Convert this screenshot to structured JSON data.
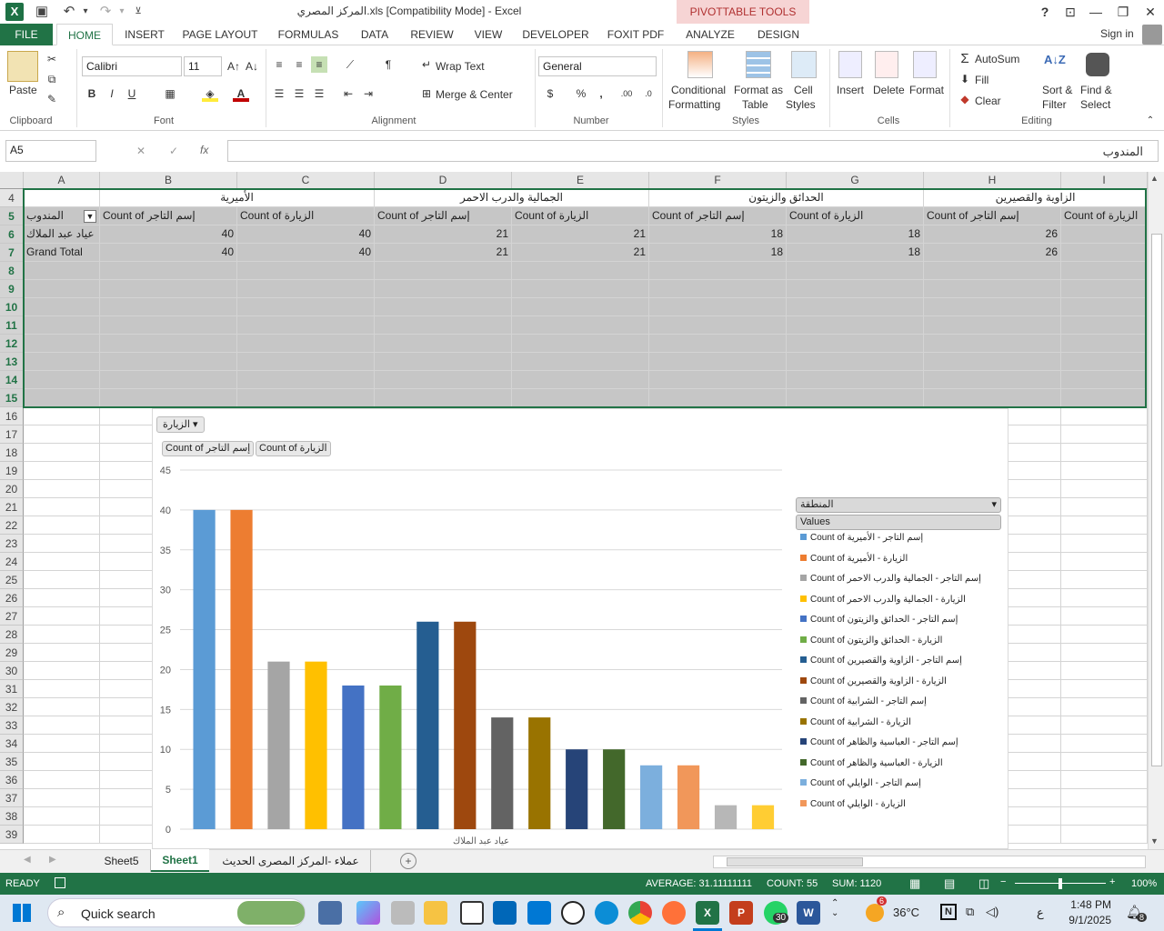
{
  "titlebar": {
    "title": "المركز المصري.xls  [Compatibility Mode] - Excel",
    "pivot_tools": "PIVOTTABLE TOOLS",
    "help": "?"
  },
  "tabs": {
    "file": "FILE",
    "home": "HOME",
    "insert": "INSERT",
    "page_layout": "PAGE LAYOUT",
    "formulas": "FORMULAS",
    "data": "DATA",
    "review": "REVIEW",
    "view": "VIEW",
    "developer": "DEVELOPER",
    "foxit": "FOXIT PDF",
    "analyze": "ANALYZE",
    "design": "DESIGN",
    "signin": "Sign in"
  },
  "ribbon": {
    "clipboard": {
      "paste": "Paste",
      "label": "Clipboard"
    },
    "font": {
      "name": "Calibri",
      "size": "11",
      "label": "Font",
      "bold": "B",
      "italic": "I",
      "underline": "U"
    },
    "alignment": {
      "wrap": "Wrap Text",
      "merge": "Merge & Center",
      "label": "Alignment"
    },
    "number": {
      "format": "General",
      "label": "Number",
      "currency": "$",
      "percent": "%",
      "comma": ","
    },
    "styles": {
      "conditional1": "Conditional",
      "conditional2": "Formatting",
      "format_as1": "Format as",
      "format_as2": "Table",
      "cell_styles1": "Cell",
      "cell_styles2": "Styles",
      "label": "Styles"
    },
    "cells": {
      "insert": "Insert",
      "delete": "Delete",
      "format": "Format",
      "label": "Cells"
    },
    "editing": {
      "autosum": "AutoSum",
      "fill": "Fill",
      "clear": "Clear",
      "sort1": "Sort &",
      "sort2": "Filter",
      "find1": "Find &",
      "find2": "Select",
      "label": "Editing"
    }
  },
  "formula_bar": {
    "name_box": "A5",
    "fx": "fx",
    "value": "المندوب"
  },
  "columns": [
    "A",
    "B",
    "C",
    "D",
    "E",
    "F",
    "G",
    "H",
    "I"
  ],
  "rows": [
    "4",
    "5",
    "6",
    "7",
    "8",
    "9",
    "10",
    "11",
    "12",
    "13",
    "14",
    "15",
    "16",
    "17",
    "18",
    "19",
    "20",
    "21",
    "22",
    "23",
    "24",
    "25",
    "26",
    "27",
    "28",
    "29",
    "30",
    "31",
    "32",
    "33",
    "34",
    "35",
    "36",
    "37",
    "38",
    "39"
  ],
  "pivot": {
    "row4": [
      "الأميرية",
      "الجمالية والدرب الاحمر",
      "الحدائق والزيتون",
      "الزاوية والقصيرين"
    ],
    "row5": [
      "المندوب",
      "Count of إسم التاجر",
      "Count of الزيارة",
      "Count of إسم التاجر",
      "Count of الزيارة",
      "Count of إسم التاجر",
      "Count of الزيارة",
      "Count of إسم التاجر",
      "Count of الزيارة"
    ],
    "row6": [
      "عياد عبد الملاك",
      "40",
      "40",
      "21",
      "21",
      "18",
      "18",
      "26",
      ""
    ],
    "row7": [
      "Grand Total",
      "40",
      "40",
      "21",
      "21",
      "18",
      "18",
      "26",
      ""
    ]
  },
  "chart_data": {
    "type": "bar",
    "filter_button": "الزيارة",
    "value_buttons": [
      "Count of إسم التاجر",
      "Count of الزيارة"
    ],
    "legend_header": "المنطقة",
    "legend_values": "Values",
    "categories": [
      "عياد عبد الملاك"
    ],
    "ylim": [
      0,
      45
    ],
    "yticks": [
      "45",
      "40",
      "35",
      "30",
      "25",
      "20",
      "15",
      "10",
      "5",
      "0"
    ],
    "grid": true,
    "legend_position": "right",
    "series": [
      {
        "name": "Count of إسم التاجر - الأميرية",
        "value": 40,
        "color": "#5b9bd5"
      },
      {
        "name": "Count of الزيارة - الأميرية",
        "value": 40,
        "color": "#ed7d31"
      },
      {
        "name": "Count of إسم التاجر - الجمالية والدرب الاحمر",
        "value": 21,
        "color": "#a5a5a5"
      },
      {
        "name": "Count of الزيارة - الجمالية والدرب الاحمر",
        "value": 21,
        "color": "#ffc000"
      },
      {
        "name": "Count of إسم التاجر - الحدائق والزيتون",
        "value": 18,
        "color": "#4472c4"
      },
      {
        "name": "Count of الزيارة - الحدائق والزيتون",
        "value": 18,
        "color": "#70ad47"
      },
      {
        "name": "Count of إسم التاجر - الزاوية والقصيرين",
        "value": 26,
        "color": "#255e91"
      },
      {
        "name": "Count of الزيارة - الزاوية والقصيرين",
        "value": 26,
        "color": "#9e480e"
      },
      {
        "name": "Count of إسم التاجر - الشرابية",
        "value": 14,
        "color": "#636363"
      },
      {
        "name": "Count of الزيارة - الشرابية",
        "value": 14,
        "color": "#997300"
      },
      {
        "name": "Count of إسم التاجر - العباسية والظاهر",
        "value": 10,
        "color": "#264478"
      },
      {
        "name": "Count of الزيارة - العباسية والظاهر",
        "value": 10,
        "color": "#43682b"
      },
      {
        "name": "Count of إسم التاجر - الوايلي",
        "value": 8,
        "color": "#7cafdd"
      },
      {
        "name": "Count of الزيارة - الوايلي",
        "value": 8,
        "color": "#f1975a"
      },
      {
        "name": "",
        "value": 3,
        "color": "#b7b7b7"
      },
      {
        "name": "",
        "value": 3,
        "color": "#ffcd33"
      }
    ]
  },
  "sheets": {
    "sheet5": "Sheet5",
    "sheet1": "Sheet1",
    "sheet3": "عملاء -المركز المصرى الحديث"
  },
  "status": {
    "ready": "READY",
    "average": "AVERAGE: 31.11111111",
    "count": "COUNT: 55",
    "sum": "SUM: 1120",
    "zoom": "100%"
  },
  "taskbar": {
    "search": "Quick search",
    "temp": "36°C",
    "time": "1:48 PM",
    "date": "9/1/2025",
    "lang": "ع",
    "weather_badge": "6",
    "notif": "8",
    "whatsapp_badge": "30"
  },
  "colors": {
    "excel_green": "#217346",
    "selection_gray": "#c6c6c6"
  }
}
